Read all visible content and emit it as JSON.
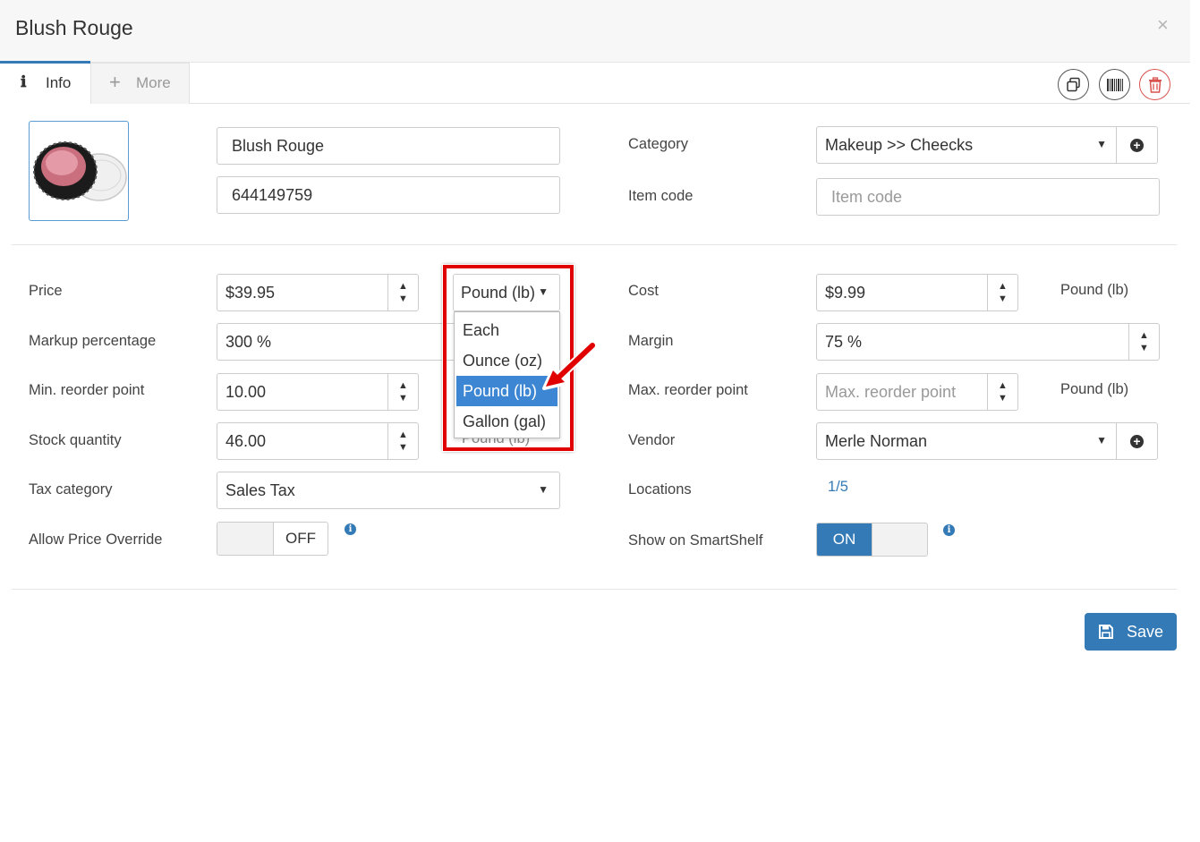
{
  "header": {
    "title": "Blush Rouge",
    "close_glyph": "×"
  },
  "tabs": [
    {
      "label": "Info",
      "icon": "info-icon",
      "glyph": "ℹ",
      "active": true
    },
    {
      "label": "More",
      "icon": "plus-icon",
      "glyph": "+",
      "active": false
    }
  ],
  "toolbar": {
    "icons": [
      "copy-icon",
      "barcode-icon",
      "trash-icon"
    ]
  },
  "item": {
    "name_value": "Blush Rouge",
    "code_value": "644149759",
    "category_label": "Category",
    "category_value": "Makeup >> Cheecks",
    "item_code_label": "Item code",
    "item_code_placeholder": "Item code"
  },
  "fields": {
    "price_label": "Price",
    "price_value": "$39.95",
    "price_unit": "Pound (lb)",
    "markup_label": "Markup percentage",
    "markup_value": "300 %",
    "min_reorder_label": "Min. reorder point",
    "min_reorder_value": "10.00",
    "stock_label": "Stock quantity",
    "stock_value": "46.00",
    "stock_unit": "Pound (lb)",
    "tax_label": "Tax category",
    "tax_value": "Sales Tax",
    "override_label": "Allow Price Override",
    "override_state": "OFF",
    "cost_label": "Cost",
    "cost_value": "$9.99",
    "cost_unit": "Pound (lb)",
    "margin_label": "Margin",
    "margin_value": "75 %",
    "max_reorder_label": "Max. reorder point",
    "max_reorder_placeholder": "Max. reorder point",
    "max_reorder_unit": "Pound (lb)",
    "vendor_label": "Vendor",
    "vendor_value": "Merle Norman",
    "locations_label": "Locations",
    "locations_value": "1/5",
    "smartshelf_label": "Show on SmartShelf",
    "smartshelf_state": "ON"
  },
  "unit_dropdown": {
    "options": [
      "Each",
      "Ounce (oz)",
      "Pound (lb)",
      "Gallon (gal)"
    ],
    "selected": "Pound (lb)"
  },
  "actions": {
    "save_label": "Save"
  },
  "colors": {
    "primary": "#337ab7",
    "highlight": "#3d86d3",
    "annotation_red": "#e00000",
    "danger": "#d9534f"
  }
}
